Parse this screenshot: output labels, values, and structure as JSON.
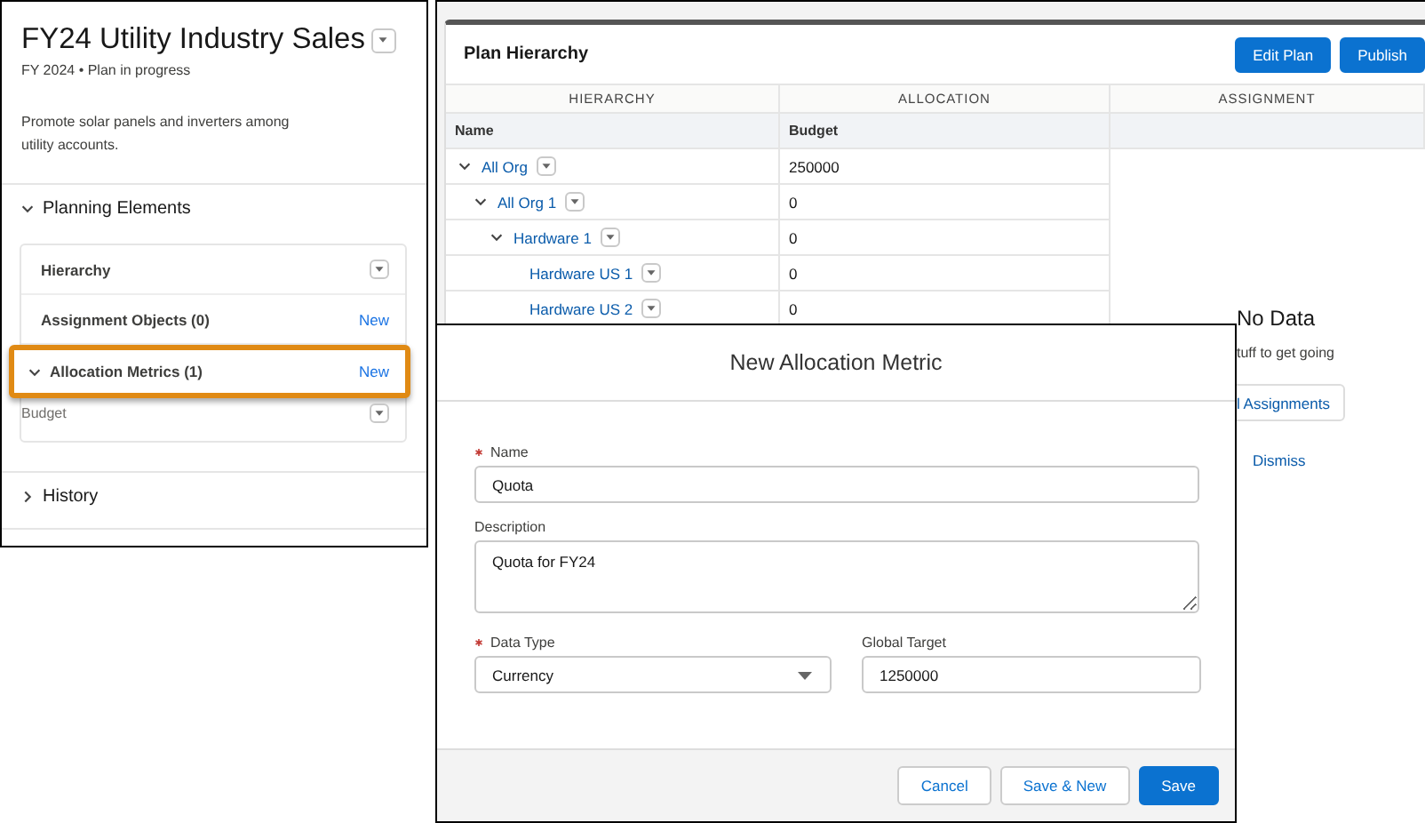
{
  "plan_panel": {
    "title": "FY24 Utility Industry Sales",
    "subtitle": "FY 2024 • Plan in progress",
    "description": "Promote solar panels and inverters among utility accounts.",
    "sections": [
      {
        "label": "Planning Elements",
        "expanded": true,
        "items": [
          {
            "label": "Hierarchy",
            "kind": "menu",
            "highlighted": false
          },
          {
            "label": "Assignment Objects (0)",
            "kind": "new",
            "action": "New",
            "highlighted": false
          },
          {
            "label": "Allocation Metrics (1)",
            "kind": "new",
            "action": "New",
            "expanded": true,
            "highlighted": true,
            "children": [
              {
                "label": "Budget"
              }
            ]
          }
        ]
      },
      {
        "label": "History",
        "expanded": false
      }
    ]
  },
  "hierarchy_panel": {
    "title": "Plan Hierarchy",
    "buttons": [
      "Edit Plan",
      "Publish"
    ],
    "column_groups": [
      "HIERARCHY",
      "ALLOCATION",
      "ASSIGNMENT"
    ],
    "columns": [
      "Name",
      "Budget"
    ],
    "rows": [
      {
        "name": "All Org",
        "budget": "250000",
        "expanded": true,
        "children": [
          {
            "name": "All Org 1",
            "budget": "0",
            "expanded": true,
            "children": [
              {
                "name": "Hardware 1",
                "budget": "0",
                "expanded": true,
                "children": [
                  {
                    "name": "Hardware US 1",
                    "budget": "0"
                  },
                  {
                    "name": "Hardware US 2",
                    "budget": "0"
                  }
                ]
              }
            ]
          }
        ]
      }
    ],
    "empty_state": {
      "title": "No Data",
      "message": "tuff to get going",
      "button": "l Assignments",
      "link": "Dismiss"
    }
  },
  "modal": {
    "title": "New Allocation Metric",
    "fields": [
      {
        "label": "Name",
        "required": true,
        "kind": "text",
        "value": "Quota"
      },
      {
        "label": "Description",
        "required": false,
        "kind": "textarea",
        "value": "Quota for FY24"
      },
      {
        "label": "Data Type",
        "required": true,
        "kind": "select",
        "value": "Currency"
      },
      {
        "label": "Global Target",
        "required": false,
        "kind": "text",
        "value": "1250000"
      }
    ],
    "buttons": [
      {
        "label": "Cancel",
        "kind": "neutral"
      },
      {
        "label": "Save & New",
        "kind": "neutral"
      },
      {
        "label": "Save",
        "kind": "brand"
      }
    ]
  }
}
